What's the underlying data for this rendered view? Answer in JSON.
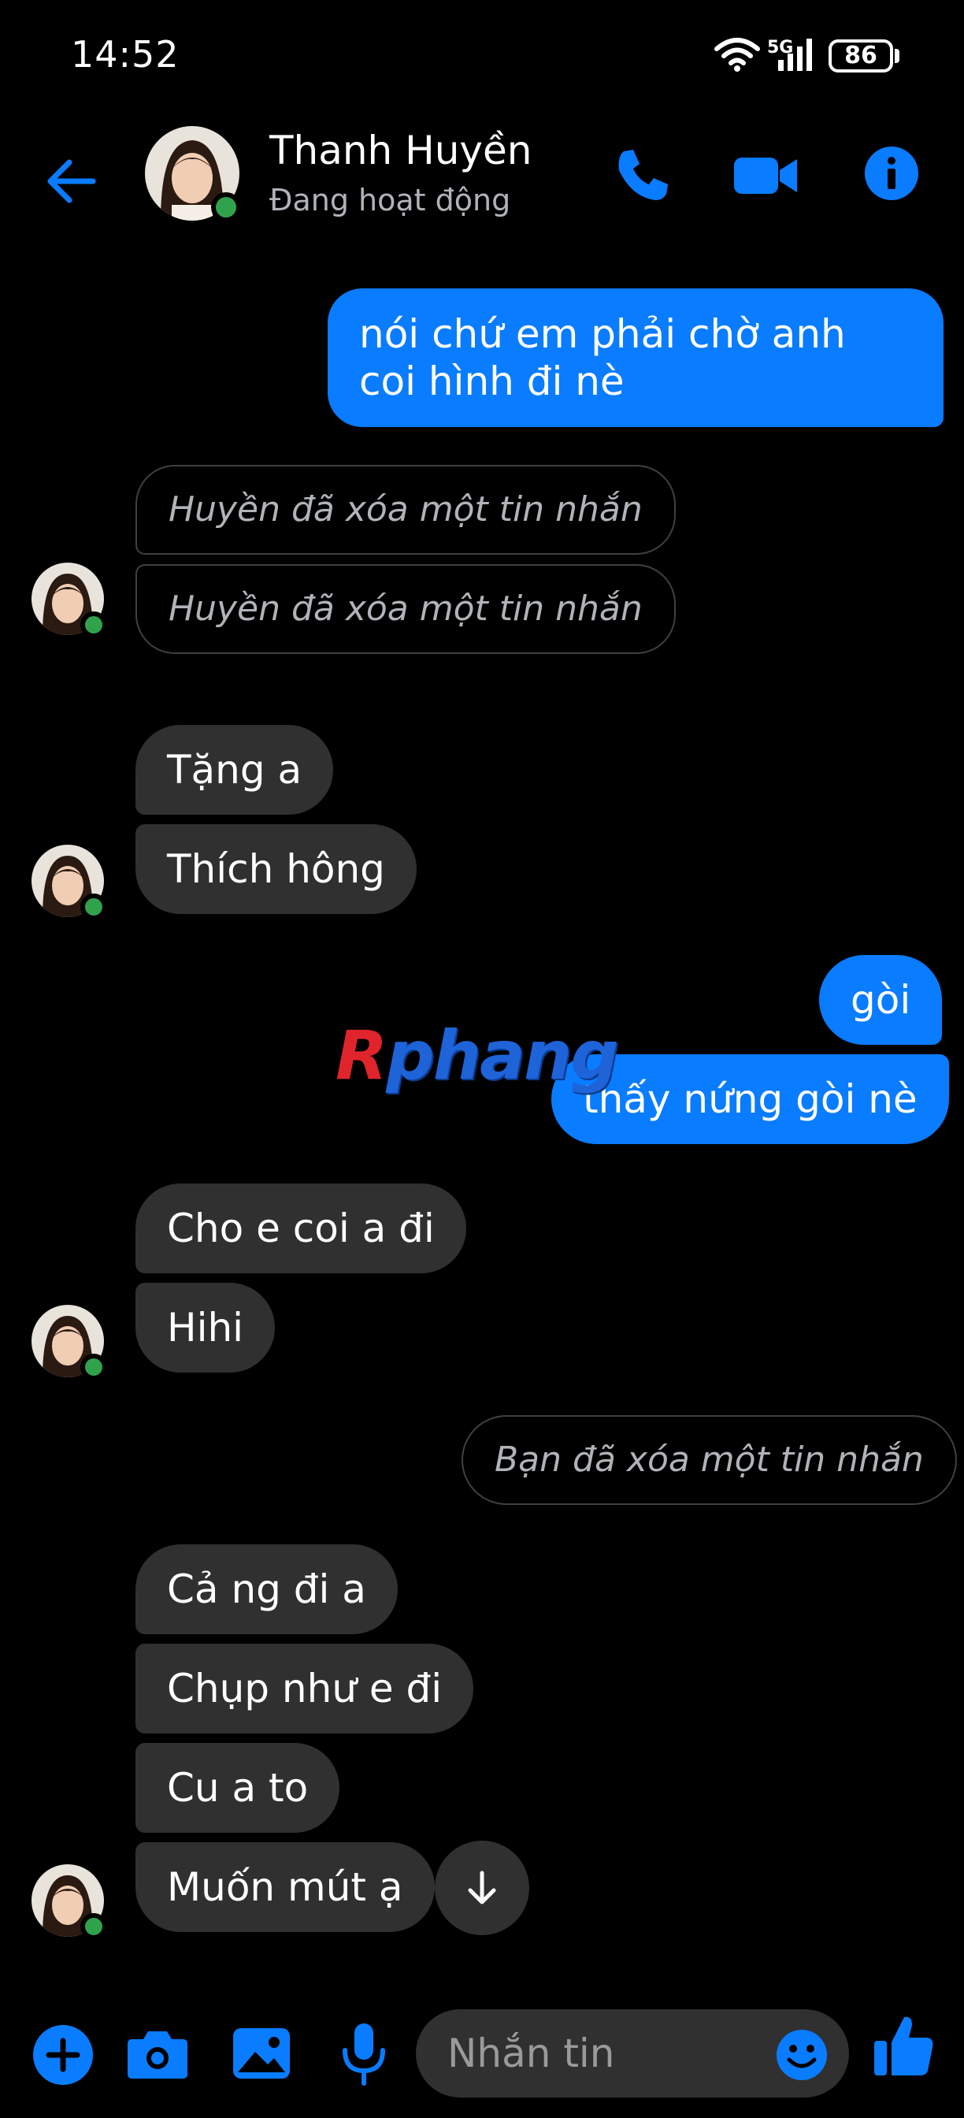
{
  "status_bar": {
    "time": "14:52",
    "network": "5G",
    "battery": "86"
  },
  "header": {
    "contact_name": "Thanh Huyền",
    "contact_status": "Đang hoạt động",
    "accent_color": "#0a7cff"
  },
  "messages": {
    "m1": "nói chứ em phải chờ anh coi hình đi nè",
    "m2": "Huyền đã xóa một tin nhắn",
    "m3": "Huyền đã xóa một tin nhắn",
    "m4": "Tặng a",
    "m5": "Thích hông",
    "m6": "gòi",
    "m7": "thấy nứng gòi nè",
    "m8": "Cho e coi a đi",
    "m9": "Hihi",
    "m10": "Bạn đã xóa một tin nhắn",
    "m11": "Cả ng đi a",
    "m12": "Chụp như e đi",
    "m13": "Cu a to",
    "m14": "Muốn mút ạ"
  },
  "watermark": {
    "first": "R",
    "rest": "phang"
  },
  "composer": {
    "placeholder": "Nhắn tin"
  },
  "icons": {
    "back": "arrow-left-icon",
    "call": "phone-icon",
    "video": "video-camera-icon",
    "info": "info-icon",
    "plus": "plus-circle-icon",
    "camera": "camera-icon",
    "gallery": "image-icon",
    "mic": "microphone-icon",
    "emoji": "emoji-icon",
    "like": "thumbs-up-icon",
    "scroll": "arrow-down-icon"
  }
}
